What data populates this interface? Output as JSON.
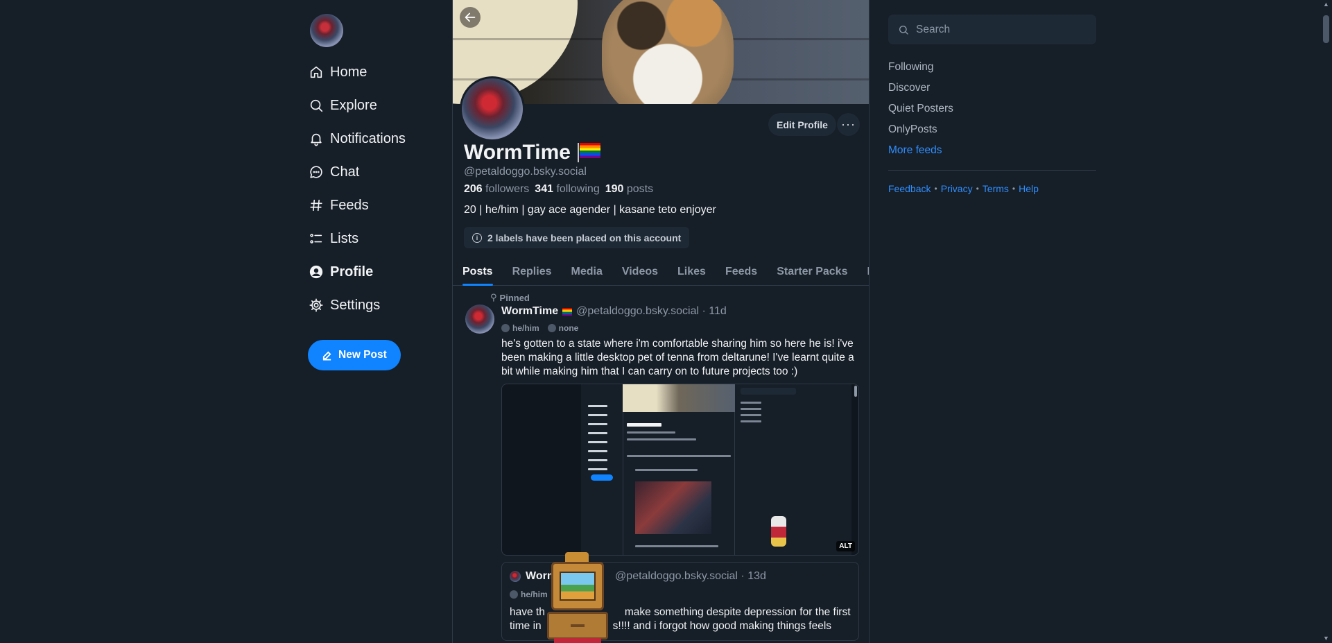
{
  "nav": {
    "items": [
      {
        "label": "Home",
        "icon": "home-icon"
      },
      {
        "label": "Explore",
        "icon": "search-icon"
      },
      {
        "label": "Notifications",
        "icon": "bell-icon"
      },
      {
        "label": "Chat",
        "icon": "chat-icon"
      },
      {
        "label": "Feeds",
        "icon": "hash-icon"
      },
      {
        "label": "Lists",
        "icon": "list-icon"
      },
      {
        "label": "Profile",
        "icon": "profile-icon"
      },
      {
        "label": "Settings",
        "icon": "gear-icon"
      }
    ],
    "new_post": "New Post"
  },
  "profile": {
    "display_name": "WormTime",
    "handle": "@petaldoggo.bsky.social",
    "followers_count": "206",
    "followers_label": "followers",
    "following_count": "341",
    "following_label": "following",
    "posts_count": "190",
    "posts_label": "posts",
    "bio": "20 | he/him | gay ace agender | kasane teto enjoyer",
    "labels_notice": "2 labels have been placed on this account",
    "edit_profile": "Edit Profile",
    "more": "···"
  },
  "tabs": [
    "Posts",
    "Replies",
    "Media",
    "Videos",
    "Likes",
    "Feeds",
    "Starter Packs",
    "Lists"
  ],
  "post": {
    "pinned": "Pinned",
    "name": "WormTime",
    "handle_time": "@petaldoggo.bsky.social · 11d",
    "pronoun": "he/him",
    "pronoun2": "none",
    "text": "he's gotten to a state where i'm comfortable sharing him so here he is! i've been making a little desktop pet of tenna from deltarune! I've learnt quite a bit while making him that I can carry on to future projects too :)",
    "alt": "ALT"
  },
  "quote": {
    "name": "Worm",
    "handle_time": "@petaldoggo.bsky.social · 13d",
    "pronoun": "he/him",
    "text_before": "have th",
    "text_after": "make something despite depression for the first",
    "line2_before": "time in",
    "line2_after": "s!!!! and i forgot how good making things feels"
  },
  "right": {
    "search_placeholder": "Search",
    "feeds": [
      "Following",
      "Discover",
      "Quiet Posters",
      "OnlyPosts"
    ],
    "more_feeds": "More feeds",
    "footer": [
      "Feedback",
      "Privacy",
      "Terms",
      "Help"
    ]
  },
  "colors": {
    "background": "#161e27",
    "accent": "#1083fe",
    "muted_text": "#8d98a7"
  }
}
